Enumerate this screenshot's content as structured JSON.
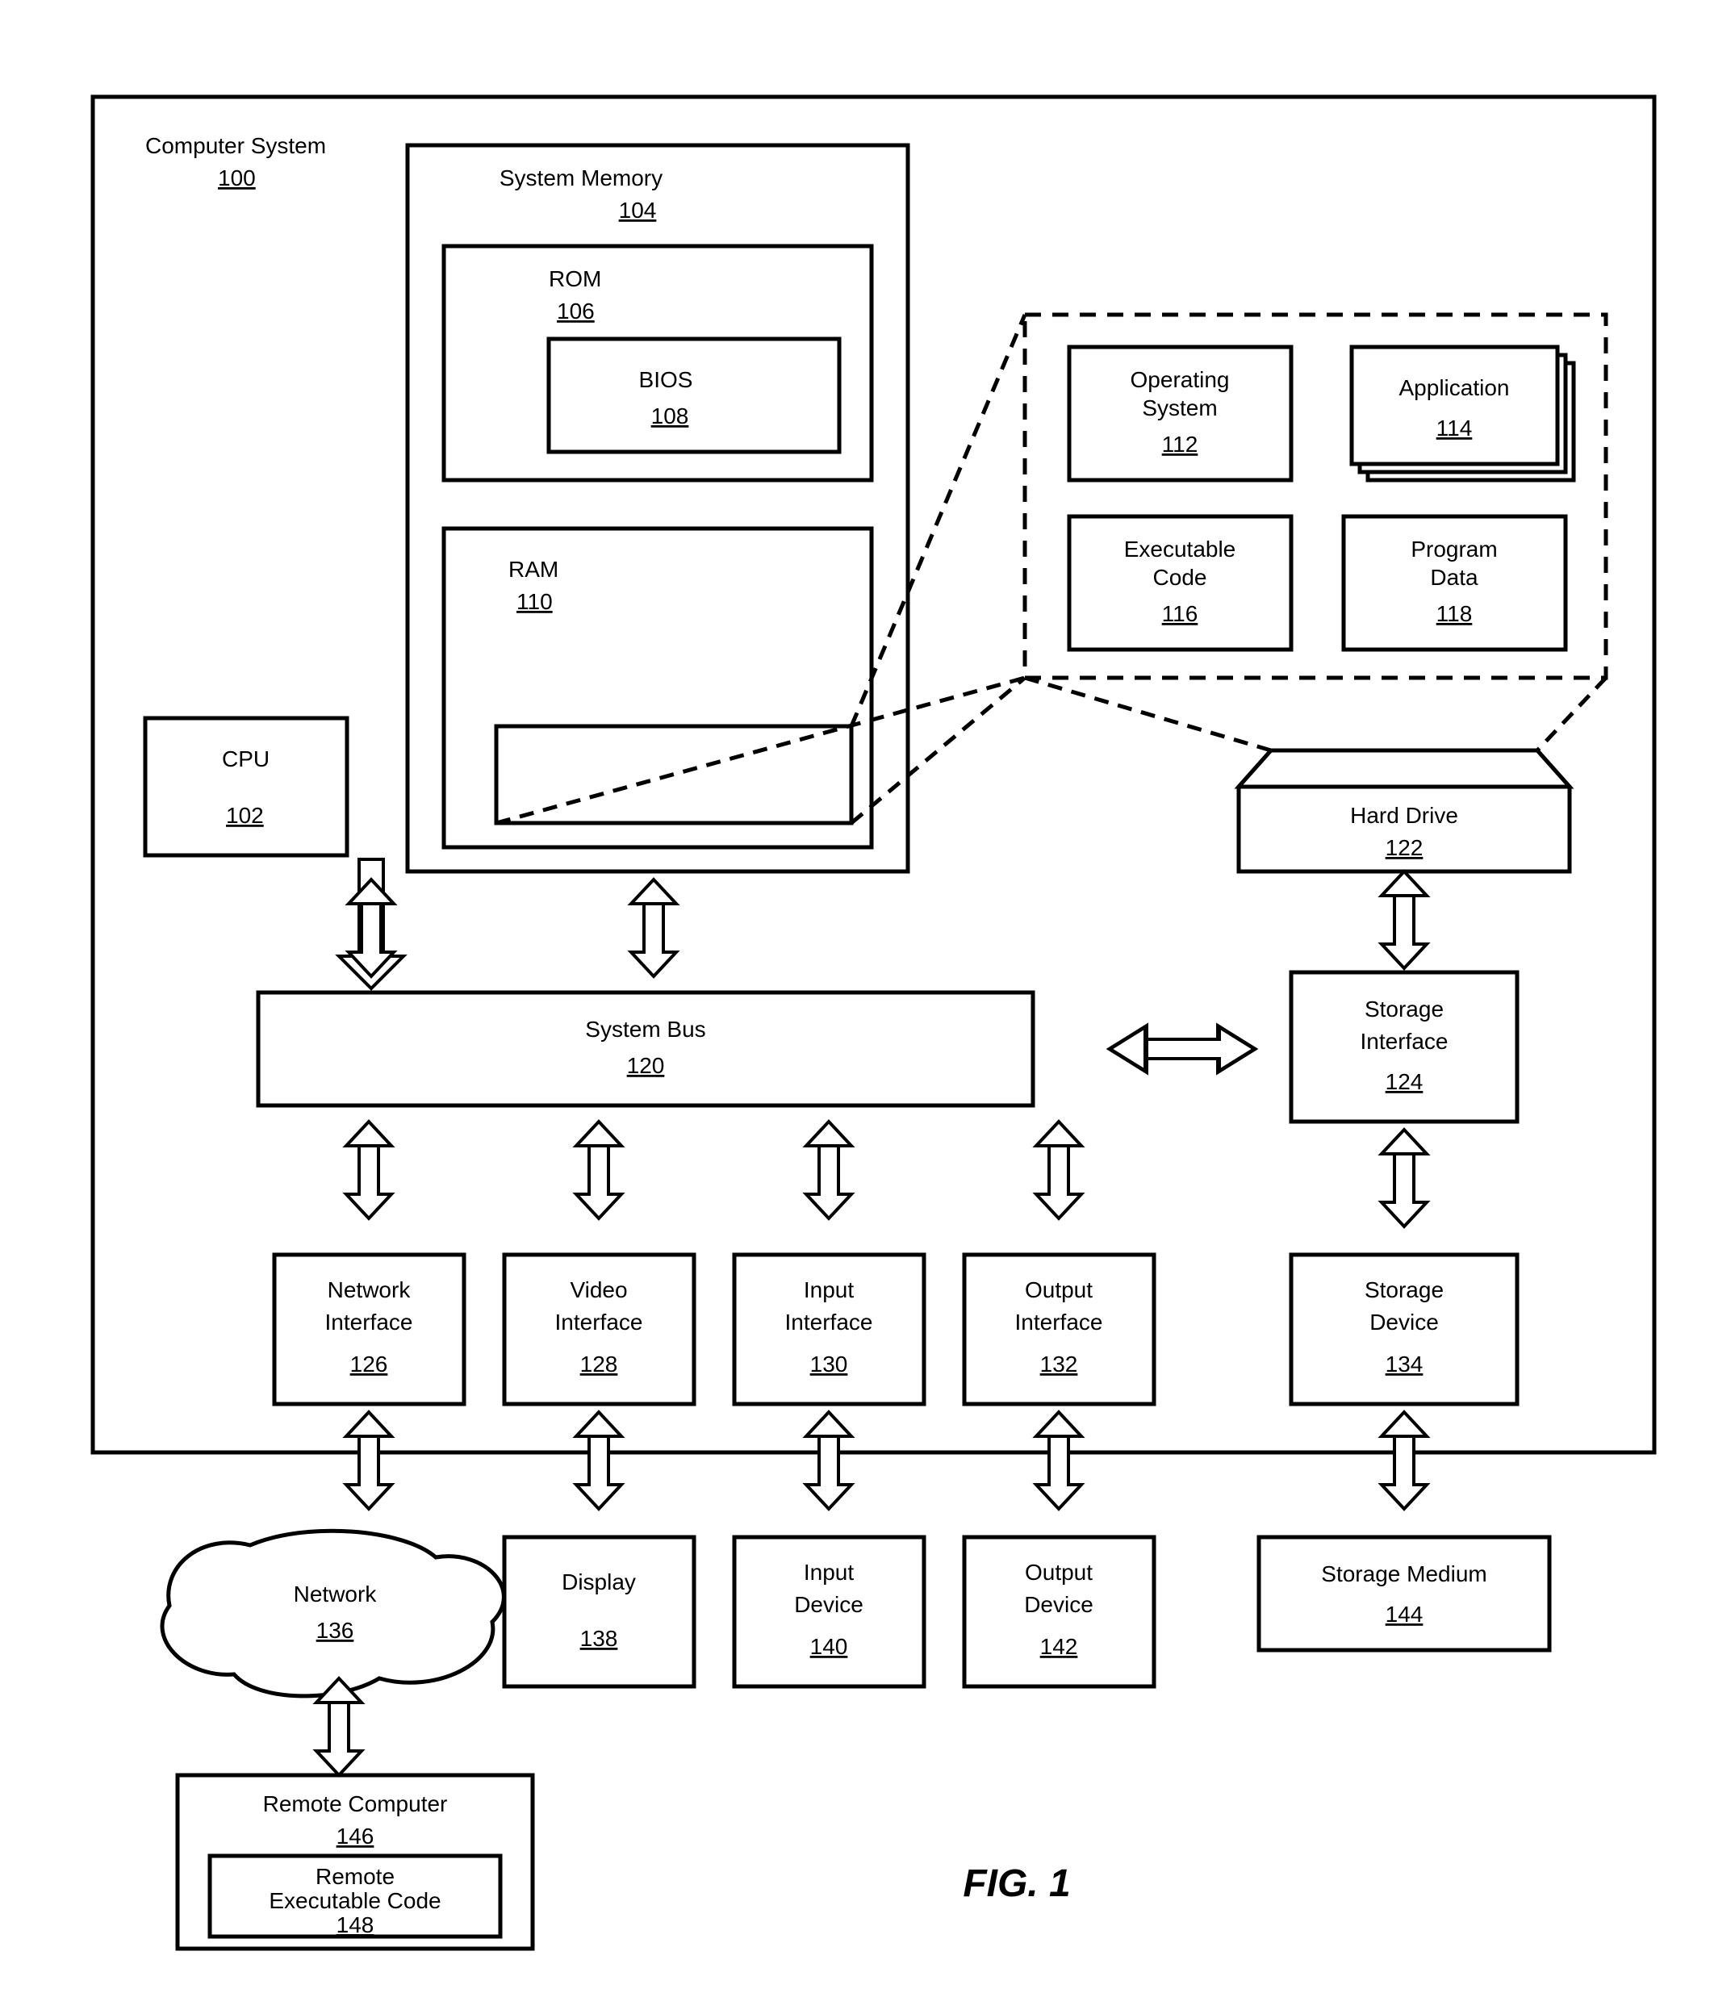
{
  "title": {
    "label": "Computer System",
    "num": "100"
  },
  "cpu": {
    "label": "CPU",
    "num": "102"
  },
  "sysmem": {
    "label": "System Memory",
    "num": "104"
  },
  "rom": {
    "label": "ROM",
    "num": "106"
  },
  "bios": {
    "label": "BIOS",
    "num": "108"
  },
  "ram": {
    "label": "RAM",
    "num": "110"
  },
  "os": {
    "label1": "Operating",
    "label2": "System",
    "num": "112"
  },
  "app": {
    "label": "Application",
    "num": "114"
  },
  "exec": {
    "label1": "Executable",
    "label2": "Code",
    "num": "116"
  },
  "pdata": {
    "label1": "Program",
    "label2": "Data",
    "num": "118"
  },
  "sysbus": {
    "label": "System Bus",
    "num": "120"
  },
  "hdd": {
    "label": "Hard Drive",
    "num": "122"
  },
  "sif": {
    "label1": "Storage",
    "label2": "Interface",
    "num": "124"
  },
  "nif": {
    "label1": "Network",
    "label2": "Interface",
    "num": "126"
  },
  "vif": {
    "label1": "Video",
    "label2": "Interface",
    "num": "128"
  },
  "iif": {
    "label1": "Input",
    "label2": "Interface",
    "num": "130"
  },
  "oif": {
    "label1": "Output",
    "label2": "Interface",
    "num": "132"
  },
  "sdev": {
    "label1": "Storage",
    "label2": "Device",
    "num": "134"
  },
  "net": {
    "label": "Network",
    "num": "136"
  },
  "disp": {
    "label": "Display",
    "num": "138"
  },
  "idev": {
    "label1": "Input",
    "label2": "Device",
    "num": "140"
  },
  "odev": {
    "label1": "Output",
    "label2": "Device",
    "num": "142"
  },
  "smed": {
    "label": "Storage Medium",
    "num": "144"
  },
  "rcomp": {
    "label": "Remote Computer",
    "num": "146"
  },
  "rexec": {
    "label1": "Remote",
    "label2": "Executable Code",
    "num": "148"
  },
  "figure": "FIG. 1"
}
